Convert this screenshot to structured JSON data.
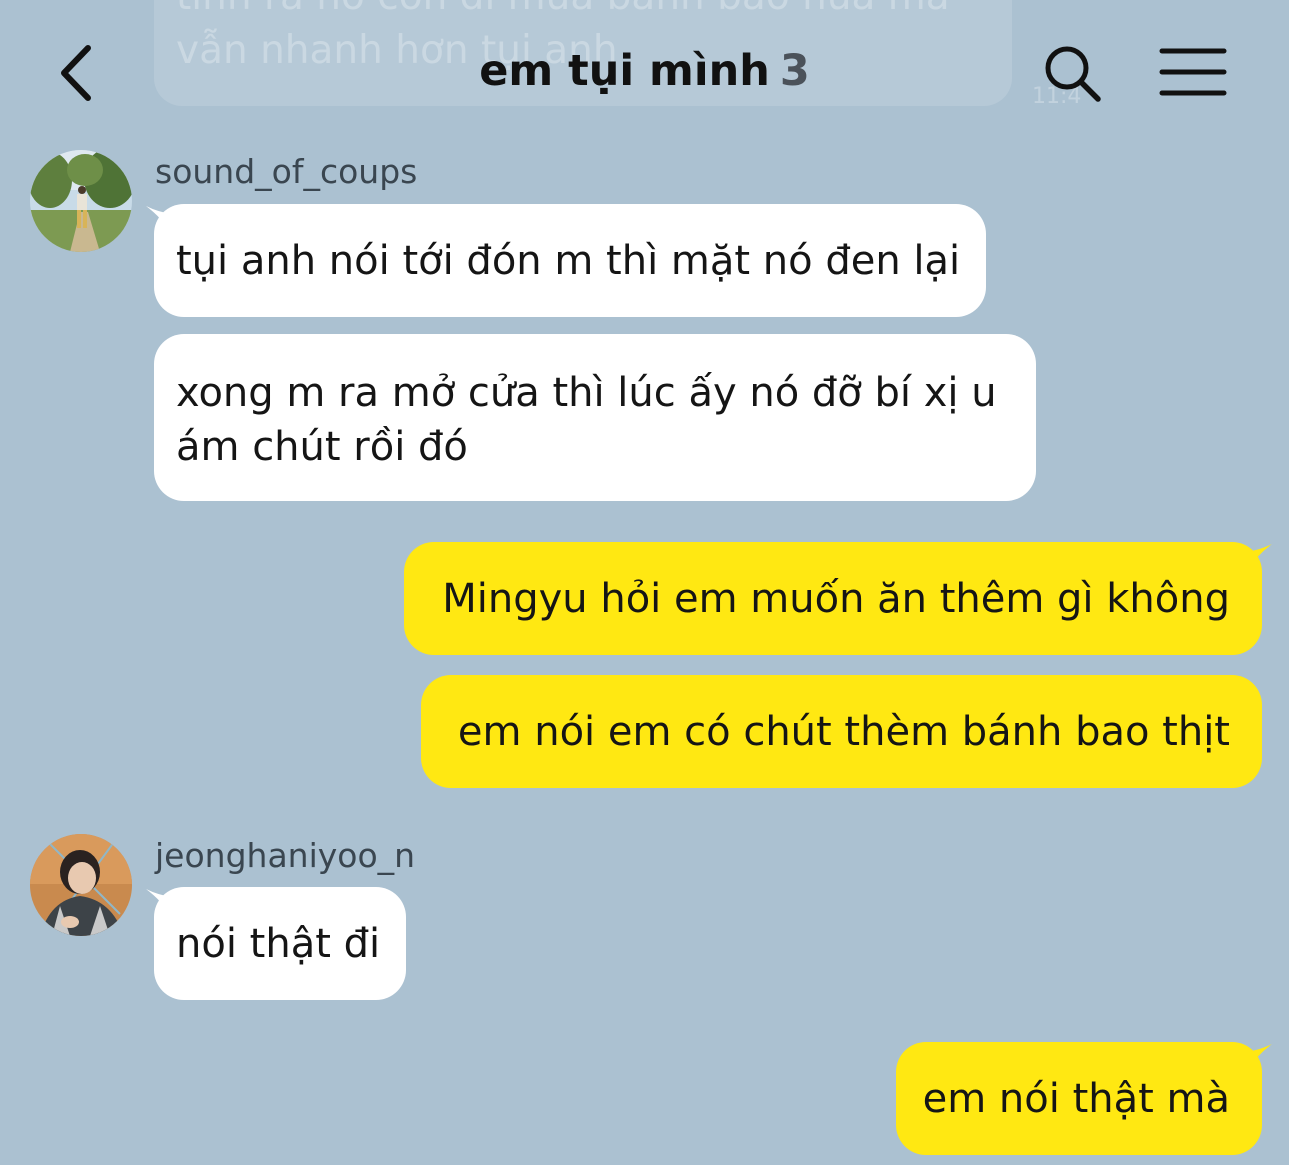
{
  "header": {
    "title": "em tụi mình",
    "member_count": "3",
    "back_icon": "chevron-left-icon",
    "search_icon": "search-icon",
    "menu_icon": "hamburger-menu-icon",
    "ghost_message": {
      "line1": "tính ra nó còn đi mua bánh bao nữa mà",
      "line2": "vẫn nhanh hơn tụi anh",
      "time": "11:4"
    }
  },
  "messages": [
    {
      "sender": "sound_of_coups",
      "direction": "incoming",
      "lines": [
        "tụi anh nói tới đón m thì mặt nó đen lại"
      ]
    },
    {
      "sender": "sound_of_coups",
      "direction": "incoming",
      "lines": [
        "xong m ra mở cửa thì lúc ấy nó đỡ bí xị u",
        "ám chút rồi đó"
      ]
    },
    {
      "direction": "outgoing",
      "lines": [
        "Mingyu hỏi em muốn ăn thêm gì không"
      ]
    },
    {
      "direction": "outgoing",
      "lines": [
        "em nói em có chút thèm bánh bao thịt"
      ]
    },
    {
      "sender": "jeonghaniyoo_n",
      "direction": "incoming",
      "lines": [
        "nói thật đi"
      ]
    },
    {
      "direction": "outgoing",
      "lines": [
        "em nói thật mà"
      ]
    }
  ],
  "colors": {
    "background": "#abc1d1",
    "incoming_bubble": "#ffffff",
    "outgoing_bubble": "#ffe812",
    "text": "#151515"
  }
}
